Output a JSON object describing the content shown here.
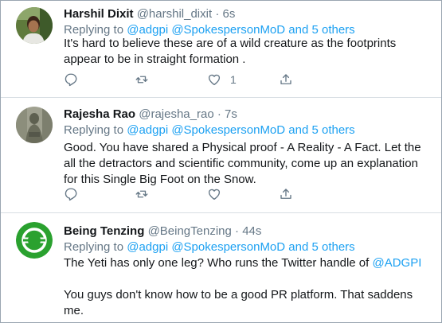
{
  "tweets": [
    {
      "name": "Harshil Dixit",
      "handle": "@harshil_dixit",
      "time": "6s",
      "replying_prefix": "Replying to",
      "replying_to": "@adgpi @SpokespersonMoD and 5 others",
      "text": "It's hard to believe these are of a wild creature as the footprints appear to be in straight formation .",
      "likes": "1"
    },
    {
      "name": "Rajesha Rao",
      "handle": "@rajesha_rao",
      "time": "7s",
      "replying_prefix": "Replying to",
      "replying_to": "@adgpi @SpokespersonMoD and 5 others",
      "text": "Good. You have shared a Physical proof  - A Reality - A Fact. Let the all the detractors and scientific community, come up an explanation for this Single Big Foot on the Snow."
    },
    {
      "name": "Being Tenzing",
      "handle": "@BeingTenzing",
      "time": "44s",
      "replying_prefix": "Replying to",
      "replying_to": "@adgpi @SpokespersonMoD and 5 others",
      "text_line1": "The Yeti has only one leg? Who runs the Twitter handle of",
      "text_mention": "@ADGPI",
      "text_line2": "You guys don't know how to be a good PR platform. That saddens me."
    }
  ],
  "separator": "·",
  "colors": {
    "link": "#1da1f2",
    "secondary": "#657786",
    "text": "#14171a",
    "avatar_lantern": "#2aa12f"
  },
  "icons": [
    "reply-icon",
    "retweet-icon",
    "like-icon",
    "share-icon"
  ]
}
